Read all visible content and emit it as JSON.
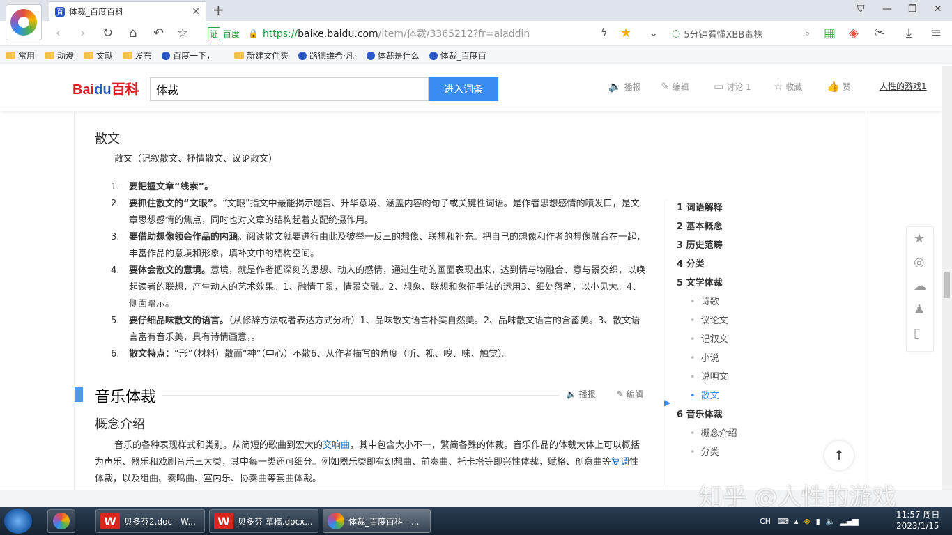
{
  "browser": {
    "tab_title": "体裁_百度百科",
    "url_shield": "证",
    "url_brand": "百度",
    "url_scheme": "https://",
    "url_host": "baike.baidu.com",
    "url_path": "/item/体裁/3365212?fr=aladdin",
    "search_text": "5分钟看懂XBB毒株",
    "bookmarks": [
      "常用",
      "动漫",
      "文献",
      "发布",
      "百度一下，",
      "新建文件夹",
      "路德维希·凡·",
      "体裁是什么",
      "体裁_百度百"
    ]
  },
  "header": {
    "logo_left": "Bai",
    "logo_du": "du",
    "logo_right": "百科",
    "search_value": "体裁",
    "enter_button": "进入词条",
    "tools": [
      "播报",
      "编辑",
      "讨论 1",
      "收藏",
      "赞"
    ],
    "user": "人性的游戏1"
  },
  "article": {
    "subheading": "散文",
    "intro": "散文（记叙散文、抒情散文、议论散文）",
    "items": [
      {
        "num": "1.",
        "bold": "要把握文章“线索”。",
        "text": ""
      },
      {
        "num": "2.",
        "bold": "要抓住散文的“文眼”",
        "text": "。“文眼”指文中最能揭示题旨、升华意境、涵盖内容的句子或关键性词语。是作者思想感情的喷发口，是文章思想感情的焦点，同时也对文章的结构起着支配统摄作用。"
      },
      {
        "num": "3.",
        "bold": "要借助想像领会作品的内涵。",
        "text": "阅读散文就要进行由此及彼举一反三的想像、联想和补充。把自己的想像和作者的想像融合在一起，丰富作品的意境和形象，填补文中的结构空间。"
      },
      {
        "num": "4.",
        "bold": "要体会散文的意境。",
        "text": "意境，就是作者把深刻的思想、动人的感情，通过生动的画面表现出来，达到情与物融合、意与景交织，以唤起读者的联想，产生动人的艺术效果。1、融情于景，情景交融。2、想象、联想和象征手法的运用3、细处落笔，以小见大。4、侧面暗示。"
      },
      {
        "num": "5.",
        "bold": "要仔细品味散文的语言。",
        "text": "（从修辞方法或者表达方式分析）1、品味散文语言朴实自然美。2、品味散文语言的含蓄美。3、散文语言富有音乐美，具有诗情画意，。"
      },
      {
        "num": "6.",
        "bold": "散文特点：",
        "text": "“形”（材料）散而“神”（中心）不散6、从作者描写的角度（听、视、嗅、味、触觉）。"
      }
    ],
    "section_title": "音乐体裁",
    "section_tools": [
      "播报",
      "编辑"
    ],
    "section_sub": "概念介绍",
    "section_para_a": "音乐的各种表现样式和类别。从简短的歌曲到宏大的",
    "section_link1": "交响曲",
    "section_para_b": "，其中包含大小不一，繁简各殊的体裁。音乐作品的体裁大体上可以概括为声乐、器乐和戏剧音乐三大类，其中每一类还可细分。例如器乐类即有幻想曲、前奏曲、托卡塔等即兴性体裁，赋格、创意曲等",
    "section_link2": "复调",
    "section_para_c": "性体裁，以及组曲、奏鸣曲、室内乐、协奏曲等套曲体裁。"
  },
  "toc": [
    {
      "label": "1  词语解释",
      "type": "main"
    },
    {
      "label": "2  基本概念",
      "type": "main"
    },
    {
      "label": "3  历史范畴",
      "type": "main"
    },
    {
      "label": "4  分类",
      "type": "main"
    },
    {
      "label": "5  文学体裁",
      "type": "main"
    },
    {
      "label": "诗歌",
      "type": "sub"
    },
    {
      "label": "议论文",
      "type": "sub"
    },
    {
      "label": "记叙文",
      "type": "sub"
    },
    {
      "label": "小说",
      "type": "sub"
    },
    {
      "label": "说明文",
      "type": "sub"
    },
    {
      "label": "散文",
      "type": "active"
    },
    {
      "label": "6  音乐体裁",
      "type": "main"
    },
    {
      "label": "概念介绍",
      "type": "sub"
    },
    {
      "label": "分类",
      "type": "sub"
    }
  ],
  "watermark": "知乎 @人性的游戏",
  "taskbar": {
    "items": [
      "贝多芬2.doc - W...",
      "贝多芬 草稿.docx...",
      "体裁_百度百科 - ..."
    ],
    "ime": "CH",
    "time": "11:57 周日",
    "date": "2023/1/15"
  }
}
